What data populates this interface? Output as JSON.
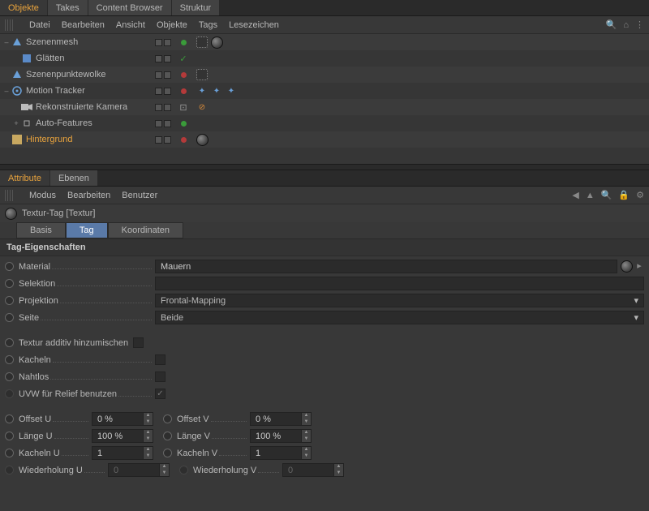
{
  "topTabs": {
    "objekte": "Objekte",
    "takes": "Takes",
    "contentBrowser": "Content Browser",
    "struktur": "Struktur"
  },
  "topMenu": {
    "datei": "Datei",
    "bearbeiten": "Bearbeiten",
    "ansicht": "Ansicht",
    "objekte": "Objekte",
    "tags": "Tags",
    "lesezeichen": "Lesezeichen"
  },
  "tree": {
    "items": [
      {
        "label": "Szenenmesh",
        "indent": 0,
        "expander": "–"
      },
      {
        "label": "Glätten",
        "indent": 1,
        "expander": ""
      },
      {
        "label": "Szenenpunktewolke",
        "indent": 0,
        "expander": ""
      },
      {
        "label": "Motion Tracker",
        "indent": 0,
        "expander": "–"
      },
      {
        "label": "Rekonstruierte Kamera",
        "indent": 1,
        "expander": ""
      },
      {
        "label": "Auto-Features",
        "indent": 1,
        "expander": "+"
      },
      {
        "label": "Hintergrund",
        "indent": 0,
        "expander": ""
      }
    ]
  },
  "attrTabs": {
    "attribute": "Attribute",
    "ebenen": "Ebenen"
  },
  "attrMenu": {
    "modus": "Modus",
    "bearbeiten": "Bearbeiten",
    "benutzer": "Benutzer"
  },
  "title": "Textur-Tag [Textur]",
  "subtabs": {
    "basis": "Basis",
    "tag": "Tag",
    "koordinaten": "Koordinaten"
  },
  "sectionHead": "Tag-Eigenschaften",
  "props": {
    "material": {
      "label": "Material",
      "value": "Mauern"
    },
    "selektion": {
      "label": "Selektion",
      "value": ""
    },
    "projektion": {
      "label": "Projektion",
      "value": "Frontal-Mapping"
    },
    "seite": {
      "label": "Seite",
      "value": "Beide"
    },
    "texturAdditiv": {
      "label": "Textur additiv hinzumischen"
    },
    "kacheln": {
      "label": "Kacheln"
    },
    "nahtlos": {
      "label": "Nahtlos"
    },
    "uvwRelief": {
      "label": "UVW für Relief benutzen"
    },
    "offsetU": {
      "label": "Offset U",
      "value": "0 %"
    },
    "offsetV": {
      "label": "Offset V",
      "value": "0 %"
    },
    "laengeU": {
      "label": "Länge U",
      "value": "100 %"
    },
    "laengeV": {
      "label": "Länge V",
      "value": "100 %"
    },
    "kachelnU": {
      "label": "Kacheln U",
      "value": "1"
    },
    "kachelnV": {
      "label": "Kacheln V",
      "value": "1"
    },
    "wiederholungU": {
      "label": "Wiederholung U",
      "value": "0"
    },
    "wiederholungV": {
      "label": "Wiederholung V",
      "value": "0"
    }
  }
}
